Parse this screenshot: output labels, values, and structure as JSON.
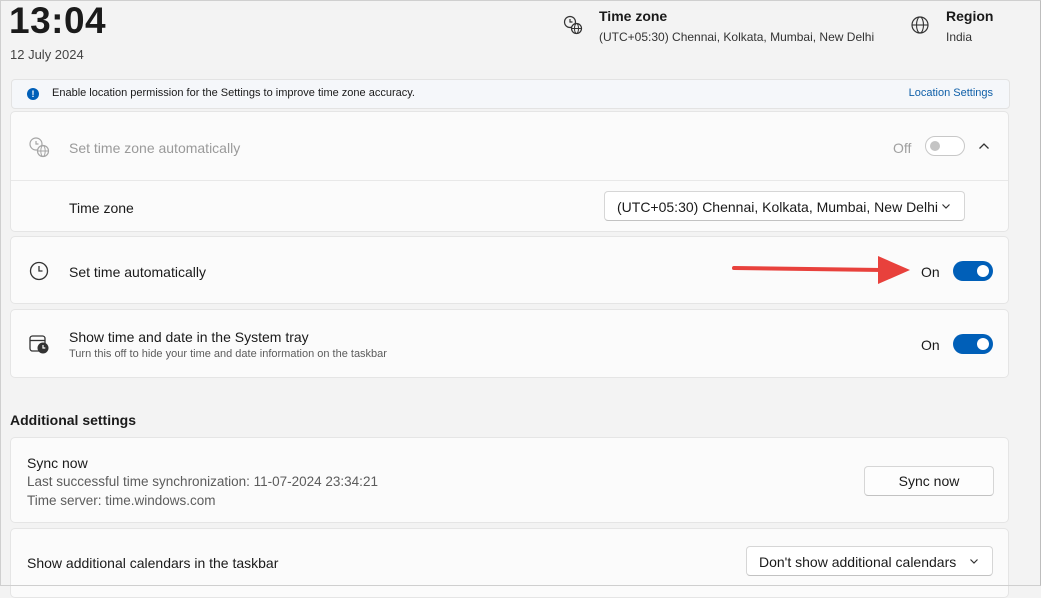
{
  "header": {
    "time": "13:04",
    "date": "12 July 2024",
    "timezone": {
      "title": "Time zone",
      "value": "(UTC+05:30) Chennai, Kolkata, Mumbai, New Delhi",
      "icon": "timezone-globe-icon"
    },
    "region": {
      "title": "Region",
      "value": "India",
      "icon": "globe-icon"
    }
  },
  "infobar": {
    "icon": "info-icon",
    "message": "Enable location permission for the Settings to improve time zone accuracy.",
    "link": "Location Settings"
  },
  "auto_timezone": {
    "label": "Set time zone automatically",
    "state": "Off",
    "enabled": false,
    "icon": "timezone-globe-icon",
    "expand_icon": "chevron-up-icon"
  },
  "timezone_row": {
    "label": "Time zone",
    "selected": "(UTC+05:30) Chennai, Kolkata, Mumbai, New Delhi"
  },
  "auto_time": {
    "label": "Set time automatically",
    "state": "On",
    "enabled": true,
    "icon": "clock-icon"
  },
  "system_tray": {
    "label": "Show time and date in the System tray",
    "description": "Turn this off to hide your time and date information on the taskbar",
    "state": "On",
    "enabled": true,
    "icon": "calendar-clock-icon"
  },
  "additional": {
    "title": "Additional settings",
    "sync": {
      "label": "Sync now",
      "last_sync": "Last successful time synchronization: 11-07-2024 23:34:21",
      "server": "Time server: time.windows.com",
      "button": "Sync now"
    },
    "calendars": {
      "label": "Show additional calendars in the taskbar",
      "selected": "Don't show additional calendars"
    }
  },
  "annotation": {
    "icon": "red-arrow-icon",
    "color": "#e8413c"
  },
  "colors": {
    "accent": "#005fb8",
    "link": "#0f5fa8",
    "background": "#f3f3f3",
    "card": "#fbfbfb"
  }
}
